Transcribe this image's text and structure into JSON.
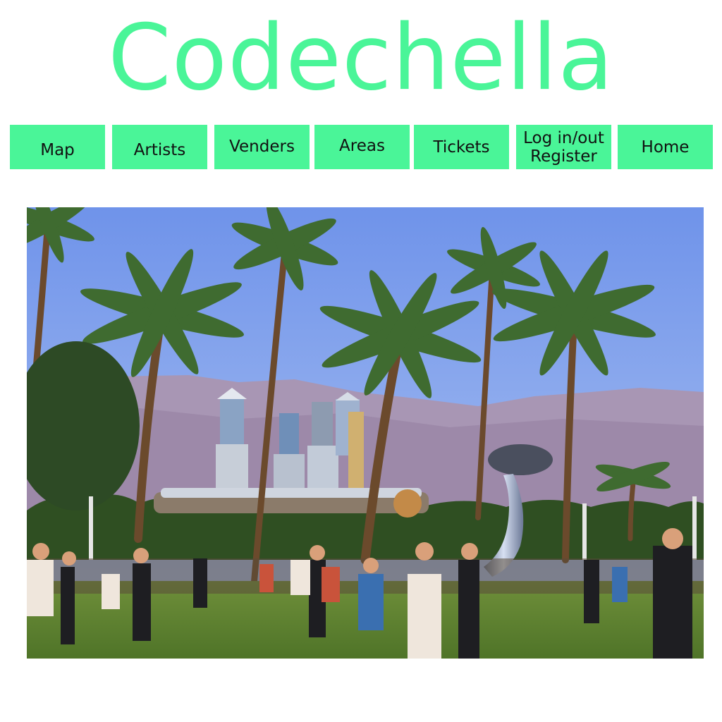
{
  "site": {
    "title": "Codechella",
    "accent_color": "#4af598"
  },
  "nav": {
    "items": [
      {
        "label": "Map"
      },
      {
        "label": "Artists"
      },
      {
        "label": "Venders"
      },
      {
        "label": "Areas"
      },
      {
        "label": "Tickets"
      },
      {
        "label_line1": "Log in/out",
        "label_line2": "Register"
      },
      {
        "label": "Home"
      }
    ]
  },
  "hero": {
    "image": "festival-crowd-palm-trees-photo"
  }
}
